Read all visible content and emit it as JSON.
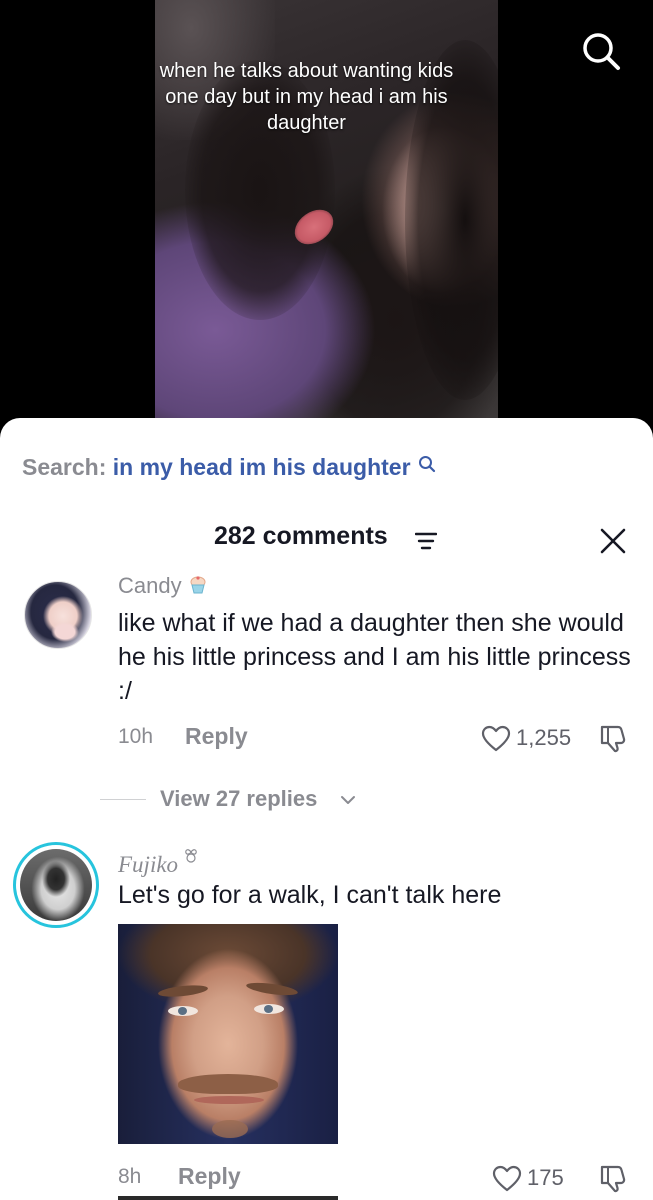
{
  "video": {
    "caption": "when he talks about wanting kids one day but in my head i am his daughter",
    "search_icon": "search-icon"
  },
  "sheet": {
    "search_prefix": "Search:",
    "search_term": "in my head im his daughter",
    "comments_count": "282 comments",
    "sort_icon": "sort-filter-icon",
    "close_icon": "close-icon"
  },
  "comments": [
    {
      "name": "Candy",
      "badge_icon": "cupcake-icon",
      "text": "like what if we had a daughter then she would he his little princess and I am his little princess :/",
      "time": "10h",
      "reply_label": "Reply",
      "likes": "1,255",
      "view_replies": "View 27 replies"
    },
    {
      "name": "Fujiko",
      "badge_icon": "bow-icon",
      "text": "Let's go for a walk, I can't talk here",
      "time": "8h",
      "reply_label": "Reply",
      "likes": "175"
    }
  ],
  "colors": {
    "accent_link": "#3b5ca8",
    "muted_text": "#8a8b91",
    "avatar_ring": "#27c4dd"
  }
}
